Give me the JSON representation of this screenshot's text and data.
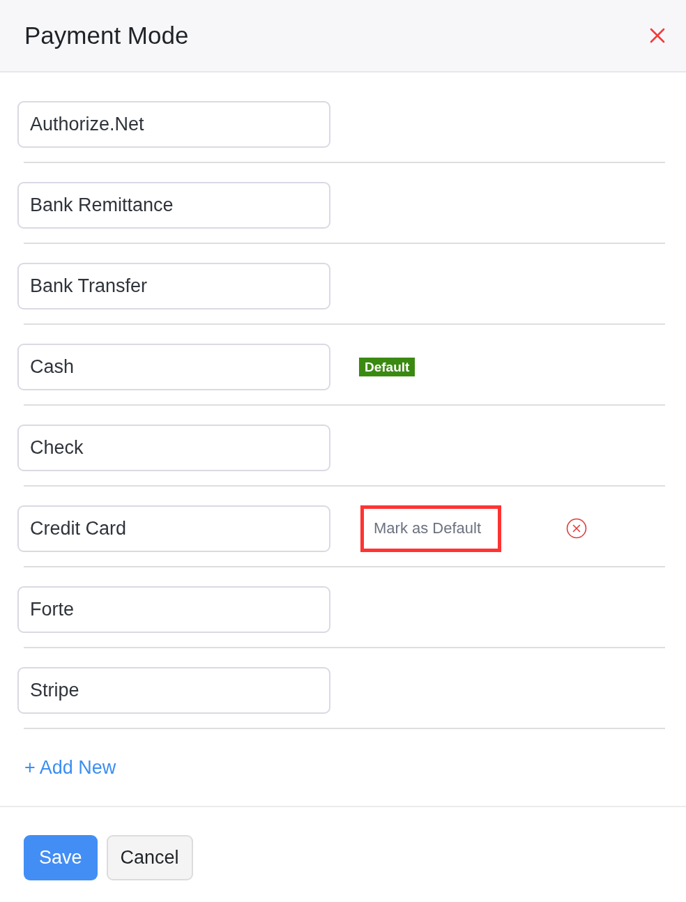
{
  "dialog": {
    "title": "Payment Mode"
  },
  "modes": [
    {
      "value": "Authorize.Net",
      "default": false,
      "hovered": false,
      "highlighted": false
    },
    {
      "value": "Bank Remittance",
      "default": false,
      "hovered": false,
      "highlighted": false
    },
    {
      "value": "Bank Transfer",
      "default": false,
      "hovered": false,
      "highlighted": false
    },
    {
      "value": "Cash",
      "default": true,
      "hovered": false,
      "highlighted": false,
      "default_label": "Default"
    },
    {
      "value": "Check",
      "default": false,
      "hovered": false,
      "highlighted": false
    },
    {
      "value": "Credit Card",
      "default": false,
      "hovered": true,
      "highlighted": true,
      "action_label": "Mark as Default"
    },
    {
      "value": "Forte",
      "default": false,
      "hovered": false,
      "highlighted": false
    },
    {
      "value": "Stripe",
      "default": false,
      "hovered": false,
      "highlighted": false
    }
  ],
  "add_link": "+ Add New",
  "buttons": [
    {
      "kind": "primary",
      "label": "Save"
    },
    {
      "kind": "secondary",
      "label": "Cancel"
    }
  ]
}
